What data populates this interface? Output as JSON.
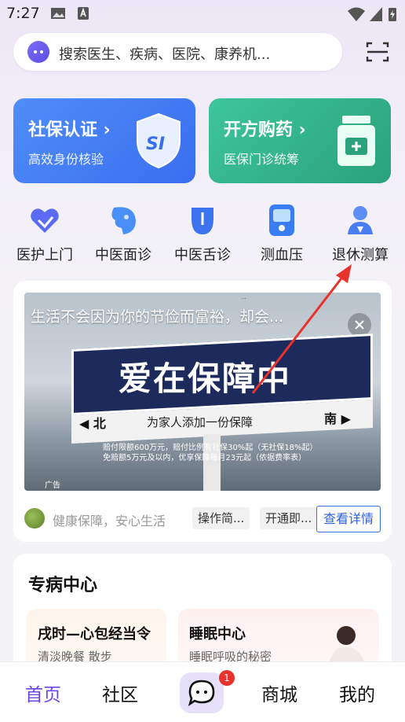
{
  "status_bar": {
    "time": "7:27"
  },
  "search": {
    "placeholder": "搜索医生、疾病、医院、康养机..."
  },
  "feature_cards": [
    {
      "title": "社保认证",
      "subtitle": "高效身份核验",
      "badge": "SI"
    },
    {
      "title": "开方购药",
      "subtitle": "医保门诊统筹"
    }
  ],
  "quick_items": [
    {
      "label": "医护上门",
      "icon": "nurse-heart-icon"
    },
    {
      "label": "中医面诊",
      "icon": "face-diagnosis-icon"
    },
    {
      "label": "中医舌诊",
      "icon": "tongue-diagnosis-icon"
    },
    {
      "label": "测血压",
      "icon": "blood-pressure-icon"
    },
    {
      "label": "退休测算",
      "icon": "retirement-calc-icon"
    }
  ],
  "ad": {
    "headline": "生活不会因为你的节俭而富裕，却会...",
    "sign_title": "爱在保障中",
    "sign_subtitle": "为家人添加一份保障",
    "dir_left": "◀ 北",
    "dir_right": "南 ▶",
    "fine_print_1": "赔付限额600万元，赔付比例有社保30%起（无社保18%起）",
    "fine_print_2": "免赔额5万元及以内，优享保障每月23元起（依据费率表）",
    "label": "广告",
    "footer_text": "健康保障，安心生活",
    "tags": [
      "操作简...",
      "开通即..."
    ],
    "detail_button": "查看详情"
  },
  "section": {
    "title": "专病中心",
    "cards": [
      {
        "title": "戌时—心包经当令",
        "subtitle": "清淡晚餐 散步"
      },
      {
        "title": "睡眠中心",
        "subtitle": "睡眠呼吸的秘密"
      }
    ]
  },
  "nav": {
    "items": [
      "首页",
      "社区",
      "商城",
      "我的"
    ],
    "active": "首页",
    "message_badge": "1"
  },
  "colors": {
    "accent": "#6b45e6",
    "blue_card": "#4f8df7",
    "green_card": "#3ec59b",
    "badge": "#e8322b"
  }
}
